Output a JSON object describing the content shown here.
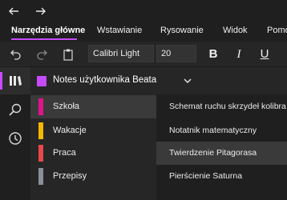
{
  "nav": {
    "back_icon": "arrow-left-icon",
    "forward_icon": "arrow-right-icon"
  },
  "tabs": [
    {
      "label": "Narzędzia główne",
      "active": true
    },
    {
      "label": "Wstawianie",
      "active": false
    },
    {
      "label": "Rysowanie",
      "active": false
    },
    {
      "label": "Widok",
      "active": false
    },
    {
      "label": "Pomoc",
      "active": false
    }
  ],
  "toolbar": {
    "undo_icon": "undo-icon",
    "redo_icon": "redo-icon",
    "clipboard_icon": "clipboard-icon",
    "font_name": "Calibri Light",
    "font_size": "20",
    "bold_label": "B",
    "italic_label": "I",
    "underline_label": "U"
  },
  "rail": {
    "notebooks_icon": "notebooks-icon",
    "search_icon": "search-icon",
    "recent_icon": "clock-icon"
  },
  "notebook": {
    "title": "Notes użytkownika Beata"
  },
  "sections": [
    {
      "label": "Szkoła",
      "color": "#e0138c",
      "selected": true
    },
    {
      "label": "Wakacje",
      "color": "#f5b800",
      "selected": false
    },
    {
      "label": "Praca",
      "color": "#e8474b",
      "selected": false
    },
    {
      "label": "Przepisy",
      "color": "#8a8f9a",
      "selected": false
    }
  ],
  "pages": [
    {
      "label": "Schemat ruchu skrzydeł kolibra",
      "selected": false
    },
    {
      "label": "Notatnik matematyczny",
      "selected": false
    },
    {
      "label": "Twierdzenie Pitagorasa",
      "selected": true
    },
    {
      "label": "Pierścienie Saturna",
      "selected": false
    }
  ],
  "colors": {
    "accent": "#c64bff",
    "background": "#1f1f1f",
    "panel": "#262626",
    "selected": "#3a3a3a"
  }
}
